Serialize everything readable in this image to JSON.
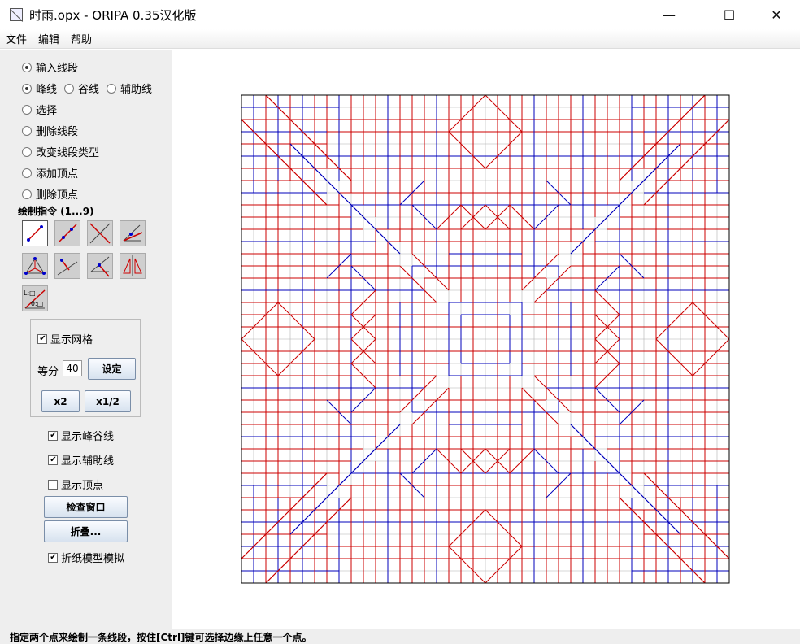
{
  "window": {
    "title": "时雨.opx - ORIPA 0.35汉化版",
    "min_glyph": "—",
    "max_glyph": "☐",
    "close_glyph": "✕"
  },
  "menu": [
    "文件",
    "编辑",
    "帮助"
  ],
  "modes": {
    "input_line": "输入线段",
    "line_types": [
      "峰线",
      "谷线",
      "辅助线"
    ],
    "select": "选择",
    "delete_line": "删除线段",
    "change_type": "改变线段类型",
    "add_vertex": "添加顶点",
    "delete_vertex": "删除顶点"
  },
  "draw_commands_label": "绘制指令 (1...9)",
  "tools": [
    "two-point-line-icon",
    "segment-extend-icon",
    "perpendicular-cross-icon",
    "angle-bisector-icon",
    "triangle-incenter-icon",
    "perpendicular-line-icon",
    "symmetric-line-icon",
    "mirror-copy-icon",
    "by-value-icon"
  ],
  "tool_by_value_text": {
    "l": "L:□",
    "a": "θ:□"
  },
  "grid": {
    "show_grid": "显示网格",
    "divide_label": "等分",
    "divide_value": "40",
    "set_button": "设定",
    "x2_button": "x2",
    "half_button": "x1/2"
  },
  "options": {
    "show_mv": "显示峰谷线",
    "show_aux": "显示辅助线",
    "show_vertices": "显示顶点",
    "check_window": "检查窗口",
    "fold": "折叠...",
    "simulate": "折纸模型模拟"
  },
  "status": "指定两个点来绘制一条线段，按住[Ctrl]键可选择边缘上任意一个点。",
  "colors": {
    "mountain": "#cc0000",
    "valley": "#0000bb",
    "grid": "#b0b0b0"
  }
}
